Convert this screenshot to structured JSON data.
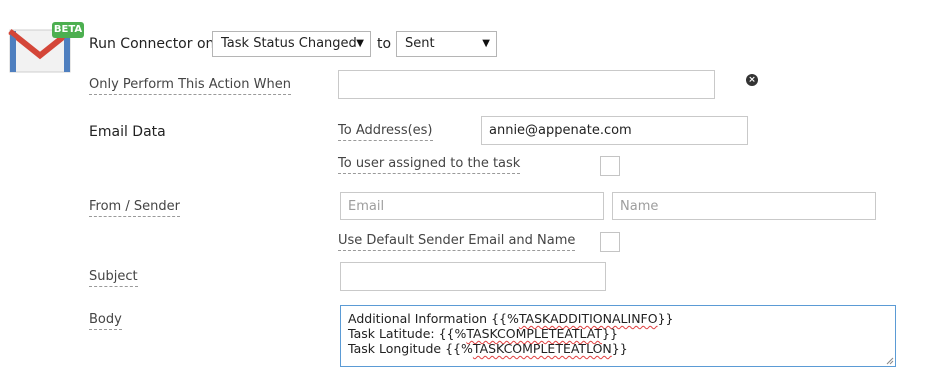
{
  "connector": {
    "logo_icon": "gmail-envelope-icon",
    "beta_badge": "BETA",
    "run_label": "Run Connector on",
    "trigger_value": "Task Status Changed",
    "to_label": "to",
    "status_value": "Sent"
  },
  "condition": {
    "label": "Only Perform This Action When",
    "value": ""
  },
  "email": {
    "section_label": "Email Data",
    "to_label": "To Address(es)",
    "to_value": "annie@appenate.com",
    "assigned_label": "To user assigned to the task",
    "from_label": "From / Sender",
    "from_email_placeholder": "Email",
    "from_name_placeholder": "Name",
    "default_sender_label": "Use Default Sender Email and Name",
    "subject_label": "Subject",
    "subject_value": "",
    "body_label": "Body",
    "body_lines": [
      {
        "prefix": "Additional Information ",
        "open": "{{%",
        "token": "TASKADDITIONALINFO",
        "close": "}}"
      },
      {
        "prefix": "Task Latitude: ",
        "open": "{{%",
        "token": "TASKCOMPLETEATLAT",
        "close": "}}"
      },
      {
        "prefix": "Task Longitude ",
        "open": "{{%",
        "token": "TASKCOMPLETEATLON",
        "close": "}}"
      }
    ]
  },
  "colors": {
    "gmail_red": "#d44638",
    "beta_green": "#4caf50",
    "focus_border": "#5b9bd5"
  }
}
